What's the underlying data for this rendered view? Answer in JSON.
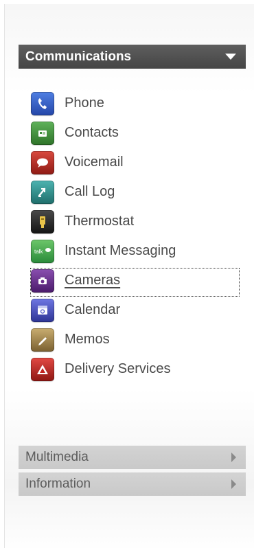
{
  "sections": {
    "communications": {
      "title": "Communications",
      "expanded": true,
      "items": [
        {
          "label": "Phone",
          "icon": "phone-icon",
          "color": "#2f5fc7"
        },
        {
          "label": "Contacts",
          "icon": "contacts-icon",
          "color": "#3f8e3a"
        },
        {
          "label": "Voicemail",
          "icon": "voicemail-icon",
          "color": "#b3261e"
        },
        {
          "label": "Call Log",
          "icon": "call-log-icon",
          "color": "#2c8f8c"
        },
        {
          "label": "Thermostat",
          "icon": "thermostat-icon",
          "color": "#2d2d2d"
        },
        {
          "label": "Instant Messaging",
          "icon": "instant-messaging-icon",
          "color": "#3aa04a"
        },
        {
          "label": "Cameras",
          "icon": "cameras-icon",
          "color": "#6a2d8c",
          "selected": true
        },
        {
          "label": "Calendar",
          "icon": "calendar-icon",
          "color": "#4a54c8"
        },
        {
          "label": "Memos",
          "icon": "memos-icon",
          "color": "#a88a4c"
        },
        {
          "label": "Delivery Services",
          "icon": "delivery-services-icon",
          "color": "#c2231f"
        }
      ]
    },
    "multimedia": {
      "title": "Multimedia",
      "expanded": false
    },
    "information": {
      "title": "Information",
      "expanded": false
    }
  }
}
